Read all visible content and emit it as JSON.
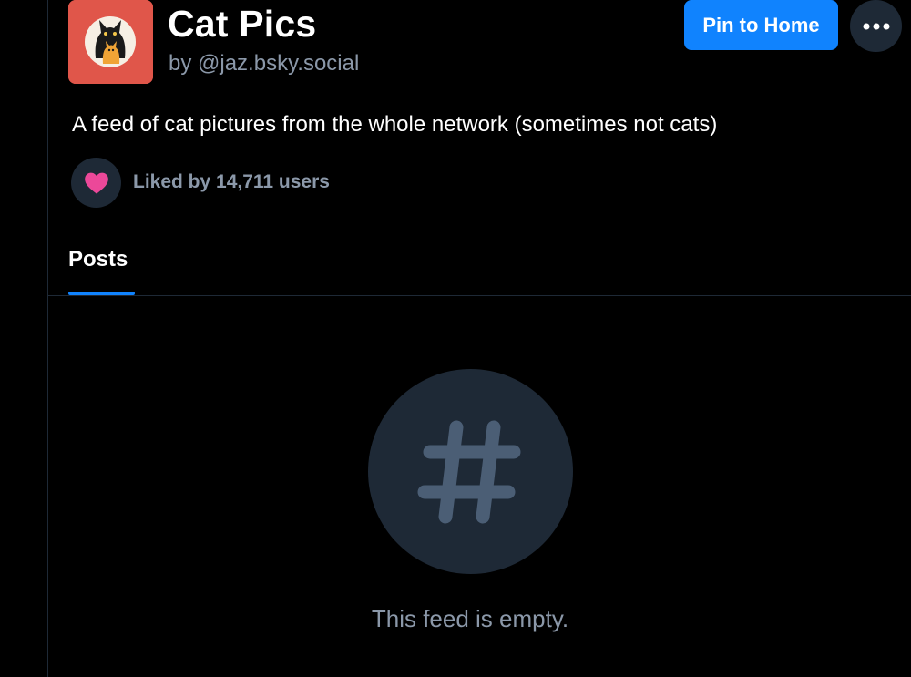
{
  "feed": {
    "title": "Cat Pics",
    "byline": "by @jaz.bsky.social",
    "description": "A feed of cat pictures from the whole network (sometimes not cats)",
    "avatar_icon": "cat-avatar-icon"
  },
  "actions": {
    "pin_label": "Pin to Home",
    "more_icon": "ellipsis-icon"
  },
  "likes": {
    "label": "Liked by 14,711 users",
    "icon": "heart-icon"
  },
  "tabs": [
    {
      "label": "Posts",
      "active": true
    }
  ],
  "empty_state": {
    "icon": "hashtag-icon",
    "message": "This feed is empty."
  },
  "colors": {
    "background": "#000000",
    "accent": "#1083fe",
    "muted_text": "#8b98a9",
    "surface": "#1e2936",
    "heart": "#ec4899",
    "avatar_bg": "#e0564a",
    "hashtag": "#4b5e75"
  }
}
